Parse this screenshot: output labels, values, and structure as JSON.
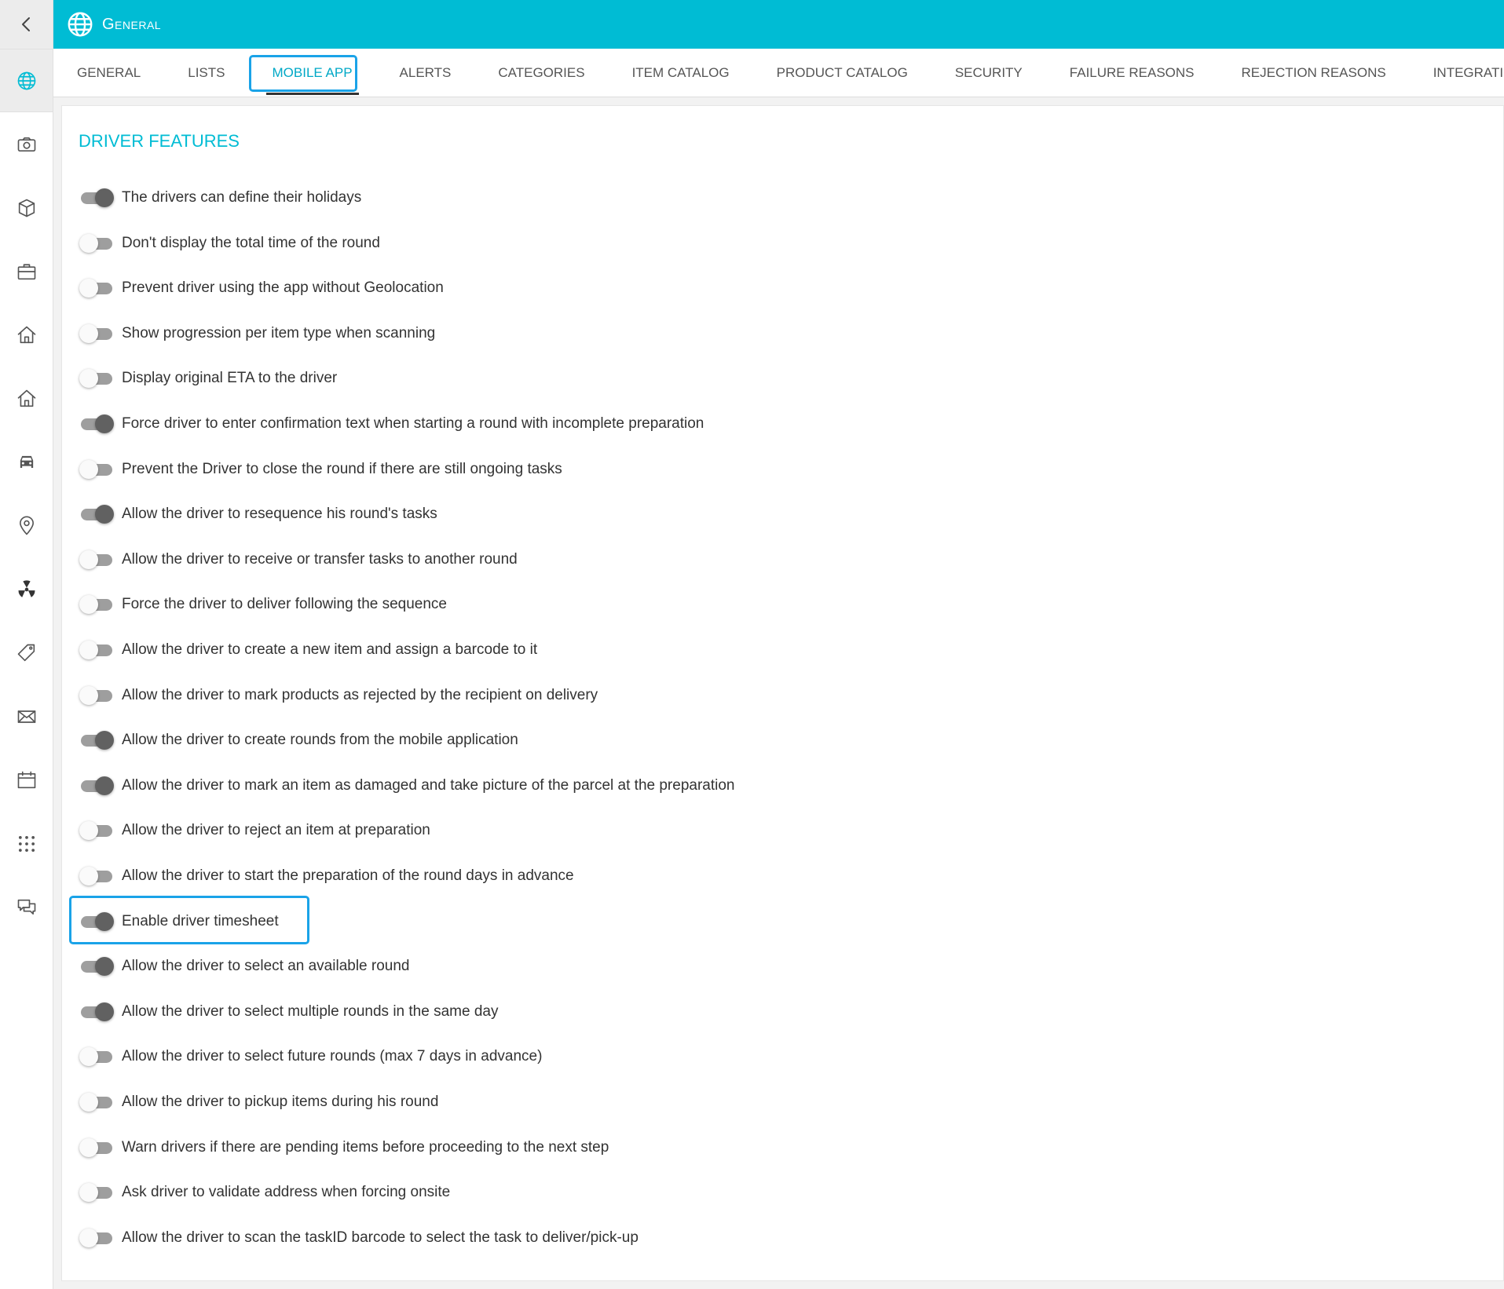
{
  "header": {
    "title": "General",
    "icon": "globe-icon",
    "accent": "#00bcd4"
  },
  "sidebar": {
    "back_icon": "chevron-left-icon",
    "items": [
      {
        "id": "globe",
        "icon": "globe-icon",
        "active": true
      },
      {
        "id": "camera",
        "icon": "camera-icon"
      },
      {
        "id": "box",
        "icon": "box-icon"
      },
      {
        "id": "briefcase",
        "icon": "briefcase-icon"
      },
      {
        "id": "home",
        "icon": "home-icon"
      },
      {
        "id": "home2",
        "icon": "warehouse-icon"
      },
      {
        "id": "car",
        "icon": "car-icon"
      },
      {
        "id": "location",
        "icon": "location-pin-icon"
      },
      {
        "id": "hazard",
        "icon": "radiation-icon"
      },
      {
        "id": "tag",
        "icon": "tag-icon"
      },
      {
        "id": "mail",
        "icon": "mail-icon"
      },
      {
        "id": "calendar",
        "icon": "calendar-icon"
      },
      {
        "id": "apps",
        "icon": "grid-dots-icon"
      },
      {
        "id": "chat",
        "icon": "chat-icon"
      }
    ]
  },
  "tabs": [
    {
      "label": "GENERAL"
    },
    {
      "label": "LISTS"
    },
    {
      "label": "MOBILE APP",
      "active": true
    },
    {
      "label": "ALERTS"
    },
    {
      "label": "CATEGORIES"
    },
    {
      "label": "ITEM CATALOG"
    },
    {
      "label": "PRODUCT CATALOG"
    },
    {
      "label": "SECURITY"
    },
    {
      "label": "FAILURE REASONS"
    },
    {
      "label": "REJECTION REASONS"
    },
    {
      "label": "INTEGRATIONS"
    }
  ],
  "section": {
    "title": "DRIVER FEATURES",
    "features": [
      {
        "label": "The drivers can define their holidays",
        "on": true
      },
      {
        "label": "Don't display the total time of the round",
        "on": false
      },
      {
        "label": "Prevent driver using the app without Geolocation",
        "on": false
      },
      {
        "label": "Show progression per item type when scanning",
        "on": false
      },
      {
        "label": "Display original ETA to the driver",
        "on": false
      },
      {
        "label": "Force driver to enter confirmation text when starting a round with incomplete preparation",
        "on": true
      },
      {
        "label": "Prevent the Driver to close the round if there are still ongoing tasks",
        "on": false
      },
      {
        "label": "Allow the driver to resequence his round's tasks",
        "on": true
      },
      {
        "label": "Allow the driver to receive or transfer tasks to another round",
        "on": false
      },
      {
        "label": "Force the driver to deliver following the sequence",
        "on": false
      },
      {
        "label": "Allow the driver to create a new item and assign a barcode to it",
        "on": false
      },
      {
        "label": "Allow the driver to mark products as rejected by the recipient on delivery",
        "on": false
      },
      {
        "label": "Allow the driver to create rounds from the mobile application",
        "on": true
      },
      {
        "label": "Allow the driver to mark an item as damaged and take picture of the parcel at the preparation",
        "on": true
      },
      {
        "label": "Allow the driver to reject an item at preparation",
        "on": false
      },
      {
        "label": "Allow the driver to start the preparation of the round days in advance",
        "on": false
      },
      {
        "label": "Enable driver timesheet",
        "on": true,
        "highlighted": true
      },
      {
        "label": "Allow the driver to select an available round",
        "on": true
      },
      {
        "label": "Allow the driver to select multiple rounds in the same day",
        "on": true
      },
      {
        "label": "Allow the driver to select future rounds (max 7 days in advance)",
        "on": false
      },
      {
        "label": "Allow the driver to pickup items during his round",
        "on": false
      },
      {
        "label": "Warn drivers if there are pending items before proceeding to the next step",
        "on": false
      },
      {
        "label": "Ask driver to validate address when forcing onsite",
        "on": false
      },
      {
        "label": "Allow the driver to scan the taskID barcode to select the task to deliver/pick-up",
        "on": false
      }
    ]
  }
}
